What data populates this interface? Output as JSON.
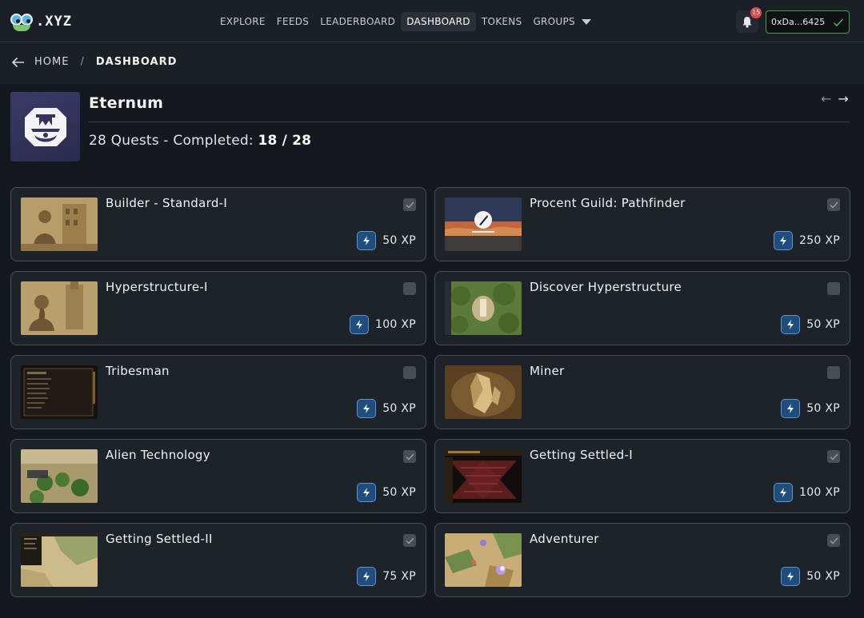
{
  "app": {
    "logo_text": ".XYZ"
  },
  "nav": {
    "items": [
      "EXPLORE",
      "FEEDS",
      "LEADERBOARD",
      "DASHBOARD",
      "TOKENS",
      "GROUPS"
    ],
    "active": "DASHBOARD",
    "notification_count": "15",
    "wallet_label": "0xDa...6425"
  },
  "breadcrumb": {
    "home": "HOME",
    "separator": "/",
    "current": "DASHBOARD"
  },
  "project": {
    "title": "Eternum",
    "quests_text": "28 Quests - Completed: ",
    "completed": "18",
    "slash": " / ",
    "total": "28",
    "pager_prev": "←",
    "pager_next": "→"
  },
  "quests": [
    {
      "title": "Builder - Standard-I",
      "xp": "50 XP",
      "completed": true,
      "thumb": "sepia-builder"
    },
    {
      "title": "Procent Guild: Pathfinder",
      "xp": "250 XP",
      "completed": true,
      "thumb": "sunset-guild"
    },
    {
      "title": "Hyperstructure-I",
      "xp": "100 XP",
      "completed": false,
      "thumb": "sepia-tower"
    },
    {
      "title": "Discover Hyperstructure",
      "xp": "50 XP",
      "completed": false,
      "thumb": "forest-map"
    },
    {
      "title": "Tribesman",
      "xp": "50 XP",
      "completed": false,
      "thumb": "dark-menu"
    },
    {
      "title": "Miner",
      "xp": "50 XP",
      "completed": false,
      "thumb": "crystal-cave"
    },
    {
      "title": "Alien Technology",
      "xp": "50 XP",
      "completed": true,
      "thumb": "hex-village"
    },
    {
      "title": "Getting Settled-I",
      "xp": "100 XP",
      "completed": true,
      "thumb": "red-hex-grid"
    },
    {
      "title": "Getting Settled-II",
      "xp": "75 XP",
      "completed": true,
      "thumb": "desert-map"
    },
    {
      "title": "Adventurer",
      "xp": "50 XP",
      "completed": true,
      "thumb": "battle-map"
    }
  ],
  "colors": {
    "check_mark": "#9a9ca0",
    "wallet_border": "#3fa34d",
    "xp_icon_bg": "#1f4d7e",
    "badge": "#e0474c"
  }
}
